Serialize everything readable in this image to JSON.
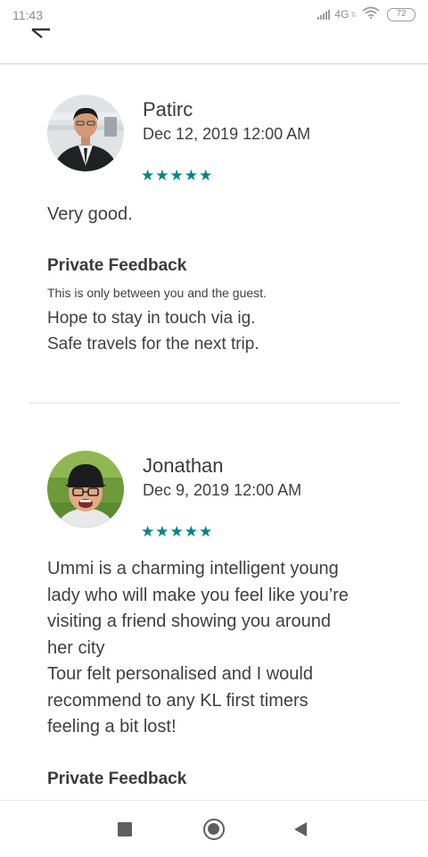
{
  "status_bar": {
    "time": "11:43",
    "network": "4G",
    "battery": "72"
  },
  "reviews": [
    {
      "name": "Patirc",
      "date": "Dec 12, 2019 12:00 AM",
      "rating": 5,
      "stars": "★★★★★",
      "text": "Very good.",
      "private_feedback_title": "Private Feedback",
      "private_feedback_note": "This is only between you and the guest.",
      "private_feedback_text": "Hope to stay in touch via ig.\nSafe travels for the next trip."
    },
    {
      "name": "Jonathan",
      "date": "Dec 9, 2019 12:00 AM",
      "rating": 5,
      "stars": "★★★★★",
      "text": "Ummi is a charming intelligent young\nlady who will make you feel like you’re\nvisiting a friend showing you around\nher city\nTour felt personalised and I would\nrecommend to any KL  first timers\nfeeling a bit lost!",
      "private_feedback_title": "Private Feedback"
    }
  ],
  "icons": {
    "back": "back-arrow-icon",
    "nav_recents": "square-icon",
    "nav_home": "circle-icon",
    "nav_back": "triangle-back-icon"
  },
  "colors": {
    "star": "#008489",
    "text": "#3f3f3f",
    "divider": "#e3e3e3"
  }
}
